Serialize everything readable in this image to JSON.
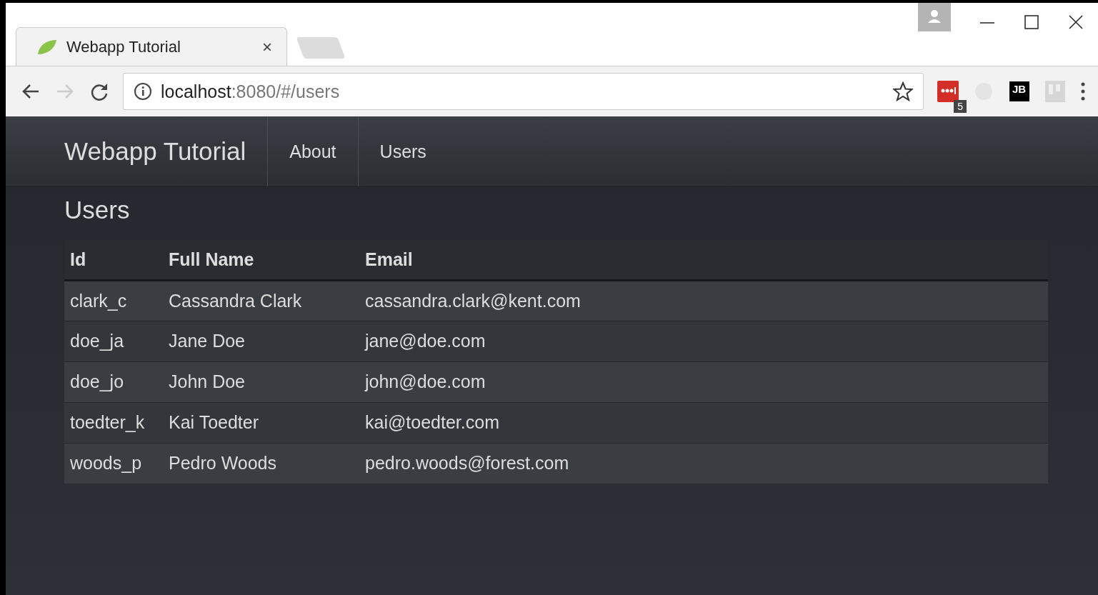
{
  "browser": {
    "tab": {
      "title": "Webapp Tutorial",
      "close": "×"
    },
    "address": {
      "host": "localhost",
      "path": ":8080/#/users"
    },
    "extensions": [
      {
        "kind": "lastpass",
        "badge": "5"
      },
      {
        "kind": "faded"
      },
      {
        "kind": "jetbrains",
        "label": "JB"
      },
      {
        "kind": "grid"
      }
    ]
  },
  "navbar": {
    "brand": "Webapp Tutorial",
    "links": [
      {
        "label": "About",
        "selected": false
      },
      {
        "label": "Users",
        "selected": false
      }
    ]
  },
  "page": {
    "heading": "Users"
  },
  "table": {
    "columns": [
      "Id",
      "Full Name",
      "Email"
    ],
    "rows": [
      [
        "clark_c",
        "Cassandra Clark",
        "cassandra.clark@kent.com"
      ],
      [
        "doe_ja",
        "Jane Doe",
        "jane@doe.com"
      ],
      [
        "doe_jo",
        "John Doe",
        "john@doe.com"
      ],
      [
        "toedter_k",
        "Kai Toedter",
        "kai@toedter.com"
      ],
      [
        "woods_p",
        "Pedro Woods",
        "pedro.woods@forest.com"
      ]
    ]
  }
}
